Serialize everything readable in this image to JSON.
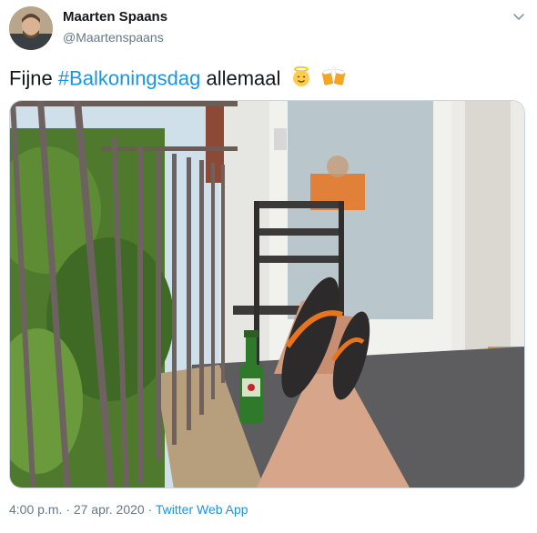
{
  "author": {
    "name": "Maarten Spaans",
    "handle": "@Maartenspaans",
    "avatar_icon": "profile-photo"
  },
  "menu": {
    "icon": "chevron-down-icon"
  },
  "tweet": {
    "text_before": "Fijne ",
    "hashtag": "#Balkoningsdag",
    "text_after": " allemaal",
    "emojis": [
      "angel-face-emoji",
      "clinking-beer-mugs-emoji"
    ]
  },
  "media": {
    "description_icon": "balcony-photo",
    "accent_orange": "#e8741e",
    "bottle_green": "#2f7a2a"
  },
  "meta": {
    "time": "4:00 p.m.",
    "separator": " · ",
    "date": "27 apr. 2020",
    "source": "Twitter Web App"
  },
  "colors": {
    "link": "#1b95e0",
    "secondary": "#657786",
    "text": "#14171a"
  }
}
